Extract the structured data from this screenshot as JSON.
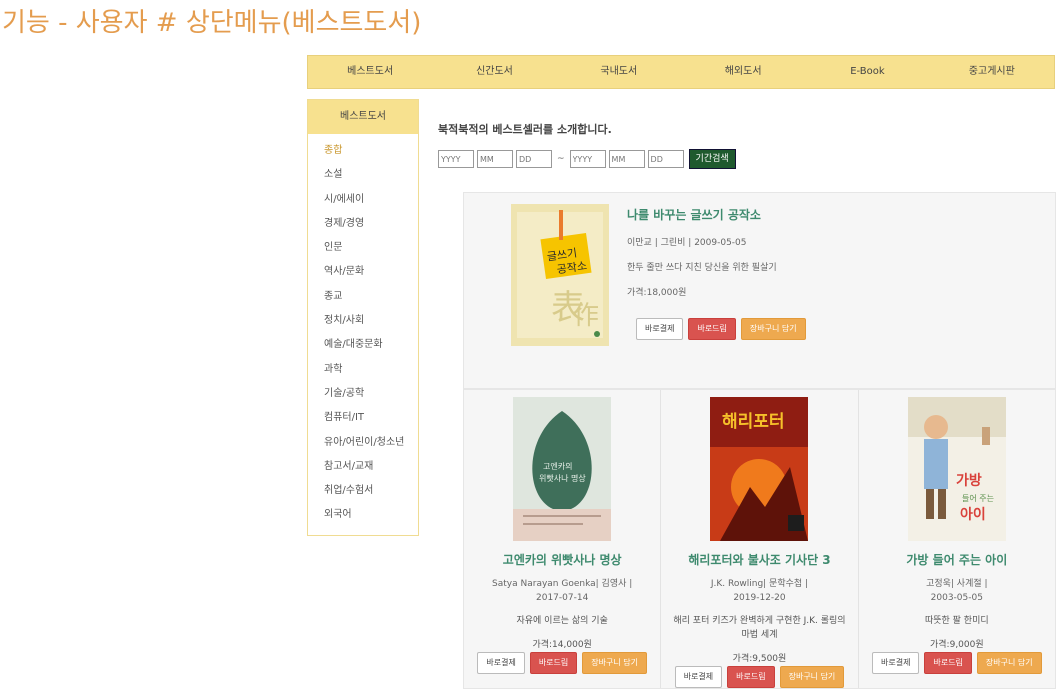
{
  "slide_title": "기능 - 사용자 # 상단메뉴(베스트도서)",
  "topnav": [
    "베스트도서",
    "신간도서",
    "국내도서",
    "해외도서",
    "E-Book",
    "중고게시판"
  ],
  "sidebar": {
    "header": "베스트도서",
    "items": [
      "종합",
      "소설",
      "시/에세이",
      "경제/경영",
      "인문",
      "역사/문화",
      "종교",
      "정치/사회",
      "예술/대중문화",
      "과학",
      "기술/공학",
      "컴퓨터/IT",
      "유아/어린이/청소년",
      "참고서/교재",
      "취업/수험서",
      "외국어"
    ]
  },
  "intro": "북적북적의 베스트셀러를 소개합니다.",
  "search": {
    "from": {
      "yyyy": "YYYY",
      "mm": "MM",
      "dd": "DD"
    },
    "tilde": "~",
    "to": {
      "yyyy": "YYYY",
      "mm": "MM",
      "dd": "DD"
    },
    "button": "기간검색"
  },
  "buttons": {
    "buy": "바로결제",
    "download": "바로드림",
    "cart": "장바구니 담기"
  },
  "featured": {
    "title": "나를 바꾸는 글쓰기 공작소",
    "meta": "이만교 | 그린비 | 2009-05-05",
    "desc": "한두 줄만 쓰다 지친 당신을 위한 필살기",
    "price": "가격:18,000원",
    "cover_text": "글쓰기 공작소"
  },
  "books": [
    {
      "title": "고엔카의 위빳사나 명상",
      "meta1": "Satya Narayan Goenka| 김영사 |",
      "meta2": "2017-07-14",
      "desc": "자유에 이르는 삶의 기술",
      "price": "가격:14,000원",
      "cover_text": "고엔카의 위빳사나 명상"
    },
    {
      "title": "해리포터와 불사조 기사단 3",
      "meta1": "J.K. Rowling| 문학수첩 |",
      "meta2": "2019-12-20",
      "desc": "해리 포터 키즈가 완벽하게 구현한 J.K. 롤링의 마법 세계",
      "price": "가격:9,500원",
      "cover_text": "해리포터"
    },
    {
      "title": "가방 들어 주는 아이",
      "meta1": "고정욱| 사계절 |",
      "meta2": "2003-05-05",
      "desc": "따뜻한 팔 한미디",
      "price": "가격:9,000원",
      "cover_text": "가방 들어 주는 아이"
    }
  ]
}
